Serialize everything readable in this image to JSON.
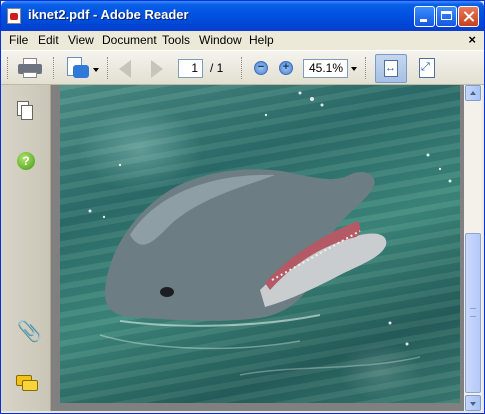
{
  "window": {
    "title": "iknet2.pdf - Adobe Reader"
  },
  "menu": {
    "items": [
      {
        "label": "File"
      },
      {
        "label": "Edit"
      },
      {
        "label": "View"
      },
      {
        "label": "Document"
      },
      {
        "label": "Tools"
      },
      {
        "label": "Window"
      },
      {
        "label": "Help"
      }
    ],
    "close_document": "×"
  },
  "toolbar": {
    "current_page": "1",
    "page_total": "/ 1",
    "zoom_level": "45.1%",
    "zoom_out_symbol": "−",
    "zoom_in_symbol": "+"
  },
  "navpane": {
    "help_symbol": "?",
    "attachment_symbol": "📎"
  },
  "document": {
    "image_subject": "dolphin-icon"
  },
  "colors": {
    "titlebar": "#0054e3",
    "workspace": "#808080",
    "water": "#2d6e6a"
  }
}
